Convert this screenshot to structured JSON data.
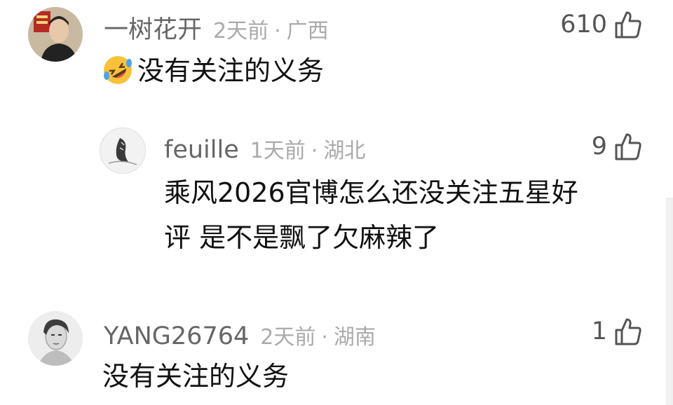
{
  "comments": [
    {
      "username": "一树花开",
      "time": "2天前",
      "separator": "·",
      "region": "广西",
      "likes": "610",
      "text": "没有关注的义务",
      "emoji": "rolling-laughing-face",
      "avatar": "user-avatar-woman"
    },
    {
      "username": "feuille",
      "time": "1天前",
      "separator": "·",
      "region": "湖北",
      "likes": "9",
      "text_line1": "乘风2026官博怎么还没关注五星好",
      "text_line2": "评 是不是飘了欠麻辣了",
      "avatar": "user-avatar-sketch"
    },
    {
      "username": "YANG26764",
      "time": "2天前",
      "separator": "·",
      "region": "湖南",
      "likes": "1",
      "text": "没有关注的义务",
      "avatar": "user-avatar-portrait"
    }
  ],
  "icons": {
    "like": "thumbs-up-icon"
  },
  "colors": {
    "username": "#666666",
    "meta": "#aaaaaa",
    "text": "#111111"
  }
}
